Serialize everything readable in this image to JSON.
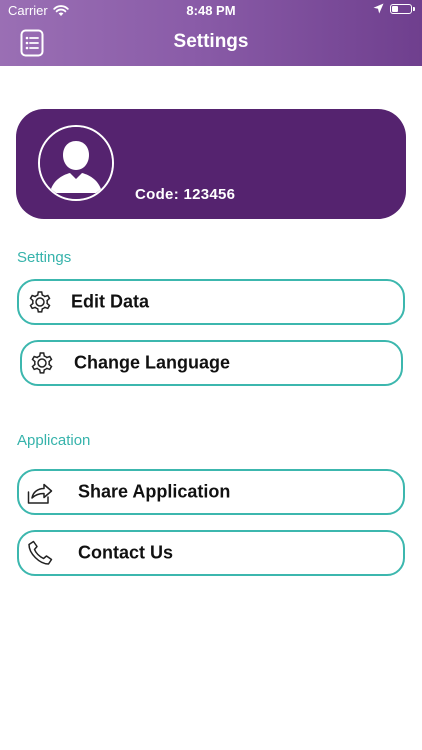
{
  "status_bar": {
    "carrier": "Carrier",
    "time": "8:48 PM"
  },
  "nav": {
    "title": "Settings",
    "menu_icon": "list-document-icon"
  },
  "profile": {
    "code_label": "Code:",
    "code_value": "123456"
  },
  "sections": {
    "settings": {
      "title": "Settings",
      "items": [
        {
          "label": "Edit Data",
          "icon": "gear-icon"
        },
        {
          "label": "Change Language",
          "icon": "gear-icon"
        }
      ]
    },
    "application": {
      "title": "Application",
      "items": [
        {
          "label": "Share Application",
          "icon": "share-icon"
        },
        {
          "label": "Contact Us",
          "icon": "phone-icon"
        }
      ]
    }
  },
  "colors": {
    "header_gradient_start": "#9a6fb4",
    "header_gradient_end": "#6f3f8e",
    "profile_card": "#55236f",
    "accent_teal": "#3cb7ae",
    "section_title": "#36b3ab"
  }
}
